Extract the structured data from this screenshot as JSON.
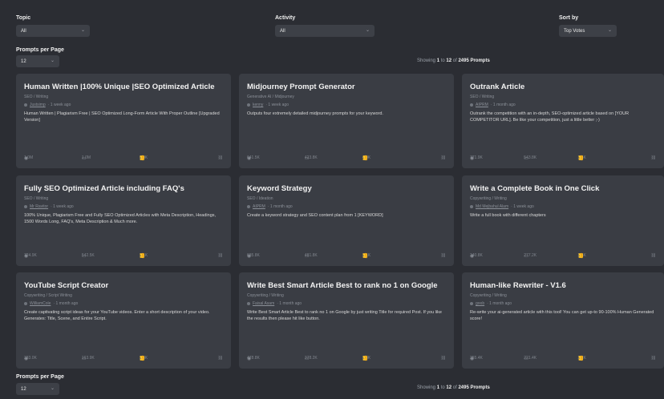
{
  "filters": {
    "topic_label": "Topic",
    "topic_value": "All",
    "activity_label": "Activity",
    "activity_value": "All",
    "sort_label": "Sort by",
    "sort_value": "Top Votes",
    "per_page_label": "Prompts per Page",
    "per_page_value": "12"
  },
  "showing": {
    "prefix": "Showing",
    "from": "1",
    "to_word": "to",
    "to": "12",
    "of_word": "of",
    "total": "2495 Prompts"
  },
  "cards": [
    {
      "title": "Human Written |100% Unique |SEO Optimized Article",
      "category": "SEO / Writing",
      "author": "Justsimp",
      "time": "· 1 week ago",
      "desc": "Human Written | Plagiarism Free | SEO Optimized Long-Form Article With Proper Outline [Upgraded Version]",
      "views": "1.0M",
      "comments": "1.0M",
      "likes": "8.9K"
    },
    {
      "title": "Midjourney Prompt Generator",
      "category": "Generative AI / Midjourney",
      "author": "kenny",
      "time": "· 1 week ago",
      "desc": "Outputs four extremely detailed midjourney prompts for your keyword.",
      "views": "641.5K",
      "comments": "423.8K",
      "likes": "4.9K"
    },
    {
      "title": "Outrank Article",
      "category": "SEO / Writing",
      "author": "AIPRM",
      "time": "· 1 month ago",
      "desc": "Outrank the competition with an in-depth, SEO-optimized article based on [YOUR COMPETITOR URL]. Be like your competition, just a little better ;-)",
      "views": "771.9K",
      "comments": "543.8K",
      "likes": "3.4K"
    },
    {
      "title": "Fully SEO Optimized Article including FAQ's",
      "category": "SEO / Writing",
      "author": "Mr Ravitor",
      "time": "· 1 week ago",
      "desc": "100% Unique, Plagiarism Free and Fully SEO Optimized Articles with Meta Description, Headings, 1500 Words Long, FAQ's, Meta Description & Much more.",
      "views": "724.9K",
      "comments": "542.5K",
      "likes": "3.1K"
    },
    {
      "title": "Keyword Strategy",
      "category": "SEO / Ideation",
      "author": "AIPRM",
      "time": "· 1 month ago",
      "desc": "Create a keyword strategy and SEO content plan from 1 [KEYWORD]",
      "views": "635.8K",
      "comments": "481.8K",
      "likes": "3.1K"
    },
    {
      "title": "Write a Complete Book in One Click",
      "category": "Copywriting / Writing",
      "author": "Md Mejbahul Alam",
      "time": "· 1 week ago",
      "desc": "Write a full book with different chapters",
      "views": "340.8K",
      "comments": "277.2K",
      "likes": "2.5K"
    },
    {
      "title": "YouTube Script Creator",
      "category": "Copywriting / Script Writing",
      "author": "WilliamCole",
      "time": "· 1 month ago",
      "desc": "Create captivating script ideas for your YouTube videos. Enter a short description of your video. Generates: Title, Scene, and Entire Script.",
      "views": "333.0K",
      "comments": "163.9K",
      "likes": "2.3K"
    },
    {
      "title": "Write Best Smart Article Best to rank no 1 on Google",
      "category": "Copywriting / Writing",
      "author": "Faisal Asam",
      "time": "· 1 month ago",
      "desc": "Write Best Smart Article Best to rank no 1 on Google by just writing Title for required Post. If you like the results then please hit like button.",
      "views": "478.8K",
      "comments": "378.2K",
      "likes": "2.3K"
    },
    {
      "title": "Human-like Rewriter - V1.6",
      "category": "Copywriting / Writing",
      "author": "goob",
      "time": "· 1 month ago",
      "desc": "Re-write your ai-generated article with this tool! You can get up-to 90-100% Human Generated score!",
      "views": "355.4K",
      "comments": "221.4K",
      "likes": "2.2K"
    }
  ],
  "icons": {
    "views": "eye-icon",
    "comments": "comment-icon",
    "likes": "thumbs-up-icon",
    "dislike": "thumbs-down-icon",
    "link": "link-icon",
    "chevron": "chevron-down-icon"
  }
}
